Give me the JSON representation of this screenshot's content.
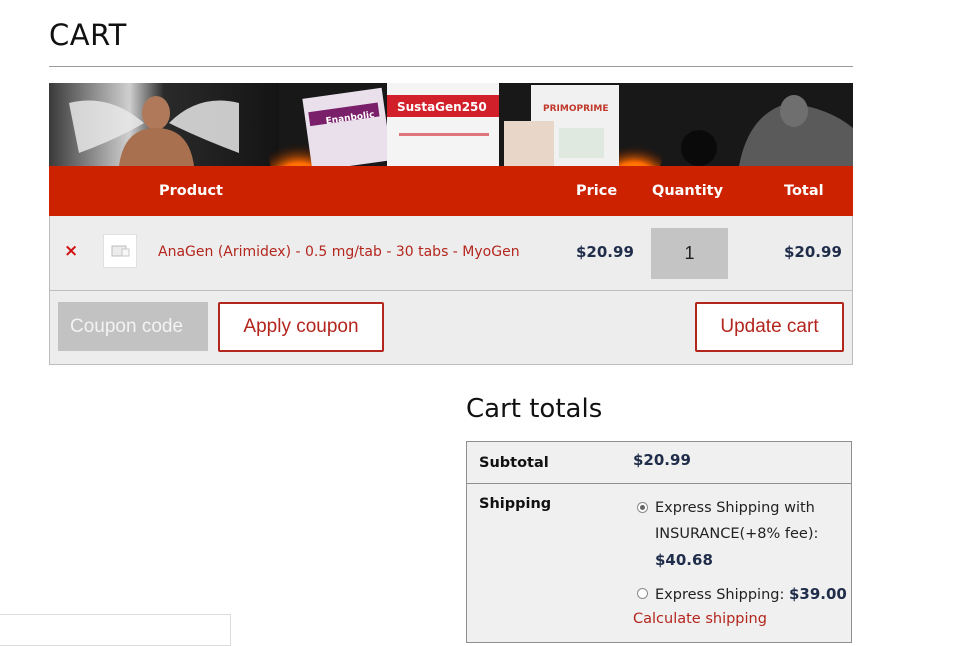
{
  "page": {
    "title": "CART"
  },
  "banner": {
    "product_labels": [
      "Enanbolic",
      "SustaGen250",
      "PRIMOPRIME"
    ]
  },
  "cart_table": {
    "headers": {
      "product": "Product",
      "price": "Price",
      "quantity": "Quantity",
      "total": "Total"
    },
    "rows": [
      {
        "remove_symbol": "×",
        "product_name": "AnaGen (Arimidex) - 0.5 mg/tab - 30 tabs - MyoGen",
        "price": "$20.99",
        "quantity": "1",
        "total": "$20.99"
      }
    ]
  },
  "actions": {
    "coupon_placeholder": "Coupon code",
    "apply_coupon_label": "Apply coupon",
    "update_cart_label": "Update cart"
  },
  "cart_totals": {
    "title": "Cart totals",
    "subtotal_label": "Subtotal",
    "subtotal_value": "$20.99",
    "shipping_label": "Shipping",
    "shipping_options": [
      {
        "label_line1": "Express Shipping with",
        "label_line2": "INSURANCE(+8% fee):",
        "price": "$40.68",
        "selected": true
      },
      {
        "label": "Express Shipping: ",
        "price": "$39.00",
        "selected": false
      }
    ],
    "calculate_shipping_label": "Calculate shipping"
  },
  "colors": {
    "accent": "#cc2200",
    "link": "#b3261e",
    "price": "#1f2d4a"
  }
}
